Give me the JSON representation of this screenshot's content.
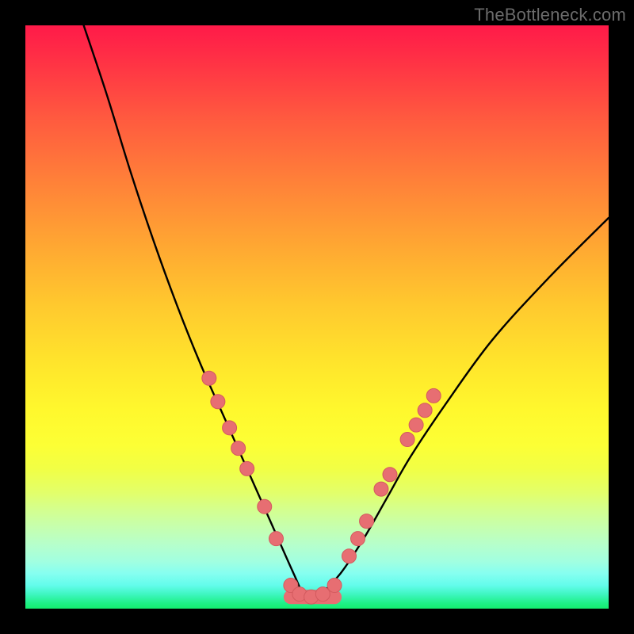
{
  "watermark": {
    "text": "TheBottleneck.com"
  },
  "colors": {
    "curve": "#000000",
    "dot_fill": "#e76e72",
    "dot_stroke": "#d35a5e",
    "background": "#000000"
  },
  "chart_data": {
    "type": "line",
    "title": "",
    "xlabel": "",
    "ylabel": "",
    "xlim": [
      0,
      100
    ],
    "ylim": [
      0,
      100
    ],
    "grid": false,
    "legend": false,
    "note": "V-shaped bottleneck curve; y expressed as percent of plot height from bottom; vertex near x≈48",
    "series": [
      {
        "name": "bottleneck-curve",
        "x": [
          10,
          14,
          18,
          22,
          26,
          30,
          34,
          38,
          42,
          46,
          48,
          50,
          54,
          58,
          62,
          66,
          72,
          80,
          90,
          100
        ],
        "y": [
          100,
          88,
          75,
          63,
          52,
          42,
          33,
          24,
          15,
          6,
          2,
          2,
          6,
          12,
          19,
          26,
          35,
          46,
          57,
          67
        ]
      }
    ],
    "markers": [
      {
        "name": "left-dot-1",
        "x": 31.5,
        "y": 39.5
      },
      {
        "name": "left-dot-2",
        "x": 33.0,
        "y": 35.5
      },
      {
        "name": "left-dot-3",
        "x": 35.0,
        "y": 31.0
      },
      {
        "name": "left-dot-4",
        "x": 36.5,
        "y": 27.5
      },
      {
        "name": "left-dot-5",
        "x": 38.0,
        "y": 24.0
      },
      {
        "name": "left-dot-6",
        "x": 41.0,
        "y": 17.5
      },
      {
        "name": "left-dot-7",
        "x": 43.0,
        "y": 12.0
      },
      {
        "name": "valley-1",
        "x": 45.5,
        "y": 4.0
      },
      {
        "name": "valley-2",
        "x": 47.0,
        "y": 2.5
      },
      {
        "name": "valley-3",
        "x": 49.0,
        "y": 2.0
      },
      {
        "name": "valley-4",
        "x": 51.0,
        "y": 2.5
      },
      {
        "name": "valley-5",
        "x": 53.0,
        "y": 4.0
      },
      {
        "name": "right-dot-1",
        "x": 55.5,
        "y": 9.0
      },
      {
        "name": "right-dot-2",
        "x": 57.0,
        "y": 12.0
      },
      {
        "name": "right-dot-3",
        "x": 58.5,
        "y": 15.0
      },
      {
        "name": "right-dot-4",
        "x": 61.0,
        "y": 20.5
      },
      {
        "name": "right-dot-5",
        "x": 62.5,
        "y": 23.0
      },
      {
        "name": "right-dot-6",
        "x": 65.5,
        "y": 29.0
      },
      {
        "name": "right-dot-7",
        "x": 67.0,
        "y": 31.5
      },
      {
        "name": "right-dot-8",
        "x": 68.5,
        "y": 34.0
      },
      {
        "name": "right-dot-9",
        "x": 70.0,
        "y": 36.5
      }
    ]
  }
}
